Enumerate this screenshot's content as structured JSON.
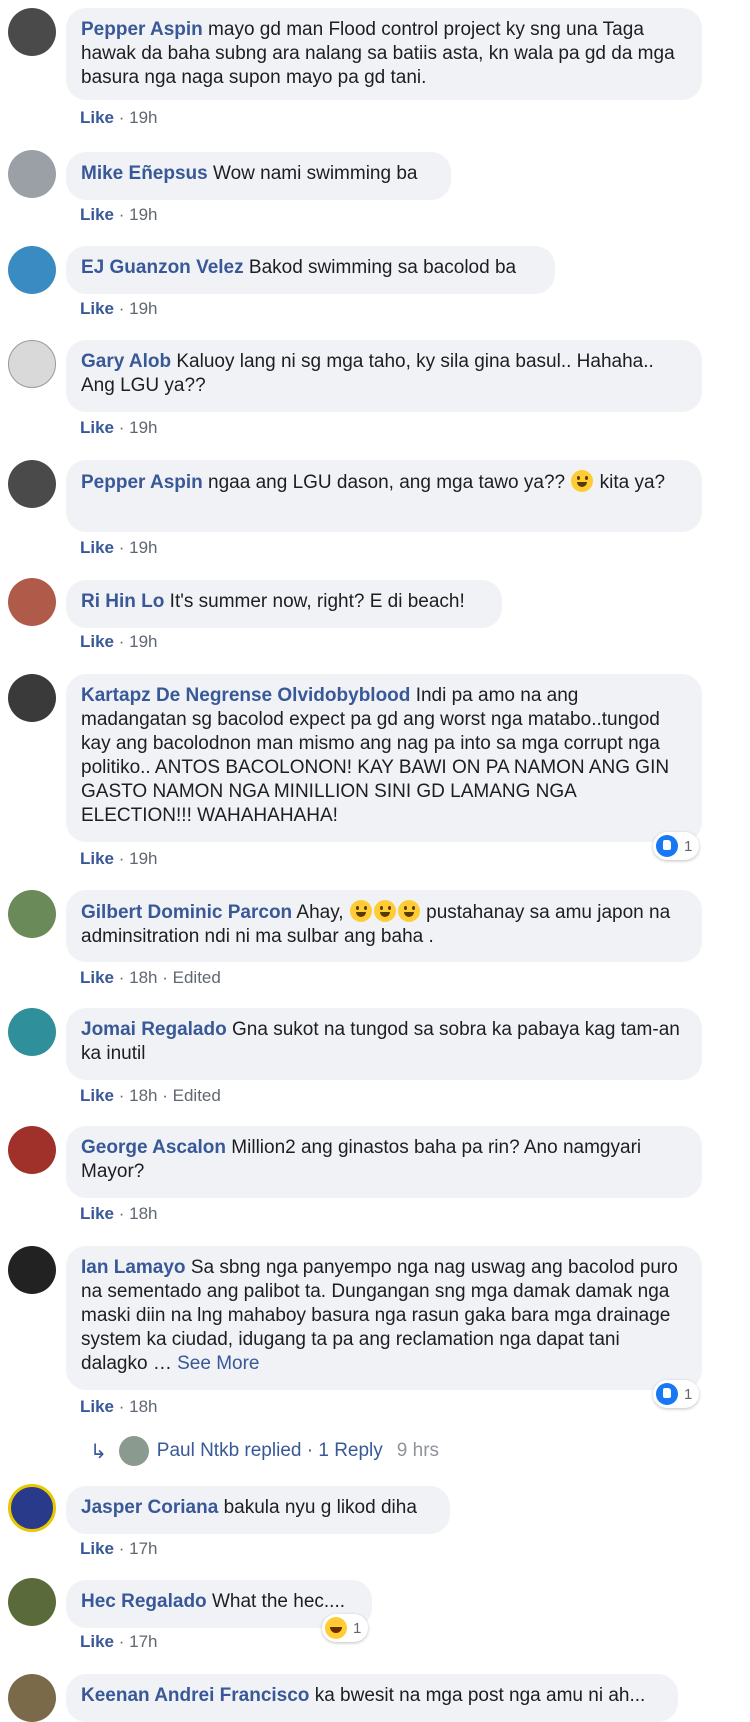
{
  "colors": {
    "author": "#385898",
    "bubble": "#f0f2f5",
    "meta": "#606770",
    "like_blue": "#1877f2"
  },
  "comments": [
    {
      "author": "Pepper Aspin",
      "text": "mayo gd man Flood control project ky sng una Taga hawak da baha subng ara nalang sa batiis asta, kn wala pa gd da mga basura nga naga supon mayo pa gd tani.",
      "like": "Like",
      "time": "19h",
      "avatar_color": "#4a4a4a"
    },
    {
      "author": "Mike Eñepsus",
      "text": "Wow nami swimming ba",
      "like": "Like",
      "time": "19h",
      "avatar_color": "#9aa0a6"
    },
    {
      "author": "EJ Guanzon Velez",
      "text": "Bakod swimming sa bacolod ba",
      "like": "Like",
      "time": "19h",
      "avatar_color": "#3a8bc2"
    },
    {
      "author": "Gary Alob",
      "text": "Kaluoy lang ni sg mga taho, ky sila gina basul.. Hahaha.. Ang LGU ya??",
      "like": "Like",
      "time": "19h",
      "avatar_color": "#d9d9d9"
    },
    {
      "author": "Pepper Aspin",
      "text_before": "ngaa ang LGU dason, ang mga tawo ya??",
      "text_after": "kita ya?",
      "emoji": "grinning-face",
      "like": "Like",
      "time": "19h",
      "avatar_color": "#4a4a4a"
    },
    {
      "author": "Ri Hin Lo",
      "text": "It's summer now, right? E di beach!",
      "like": "Like",
      "time": "19h",
      "avatar_color": "#b05a4a"
    },
    {
      "author": "Kartapz De Negrense Olvidobyblood",
      "text": "Indi pa amo na ang madangatan sg bacolod expect pa gd ang worst nga matabo..tungod kay ang bacolodnon man mismo ang nag pa into sa mga corrupt nga politiko.. ANTOS BACOLONON! KAY BAWI ON PA NAMON ANG GIN GASTO NAMON NGA MINILLION SINI GD LAMANG NGA ELECTION!!! WAHAHAHAHA!",
      "like": "Like",
      "time": "19h",
      "reaction_count": "1",
      "avatar_color": "#3a3a3a"
    },
    {
      "author": "Gilbert Dominic Parcon",
      "text_before": "Ahay,",
      "text_after": "pustahanay sa amu japon na adminsitration ndi ni ma sulbar ang baha .",
      "emoji": "grinning-face",
      "like": "Like",
      "time": "18h",
      "edited": "Edited",
      "avatar_color": "#6a8a5a"
    },
    {
      "author": "Jomai Regalado",
      "text": "Gna sukot na tungod sa sobra ka pabaya kag tam-an ka inutil",
      "like": "Like",
      "time": "18h",
      "edited": "Edited",
      "avatar_color": "#2f8f9a"
    },
    {
      "author": "George Ascalon",
      "text": "Million2 ang ginastos baha pa rin? Ano namgyari Mayor?",
      "like": "Like",
      "time": "18h",
      "avatar_color": "#a0302a"
    },
    {
      "author": "Ian Lamayo",
      "text": "Sa sbng nga panyempo nga nag uswag ang bacolod puro na sementado ang palibot ta. Dungangan sng mga damak damak nga maski diin na lng mahaboy basura nga rasun gaka bara mga drainage system ka ciudad, idugang ta pa ang reclamation nga dapat tani dalagko …",
      "see_more": "See More",
      "like": "Like",
      "time": "18h",
      "reaction_count": "1",
      "avatar_color": "#222222"
    },
    {
      "author": "Jasper Coriana",
      "text": "bakula nyu g likod diha",
      "like": "Like",
      "time": "17h",
      "avatar_color": "#2a3a8a"
    },
    {
      "author": "Hec Regalado",
      "text": "What the hec....",
      "like": "Like",
      "time": "17h",
      "reaction_count": "1",
      "avatar_color": "#5a6a3a"
    },
    {
      "author": "Keenan Andrei Francisco",
      "text": "ka bwesit na mga post nga amu ni ah...",
      "avatar_color": "#7a6a4a"
    }
  ],
  "reply": {
    "name": "Paul Ntkb replied",
    "count": "1 Reply",
    "time": "9 hrs"
  }
}
